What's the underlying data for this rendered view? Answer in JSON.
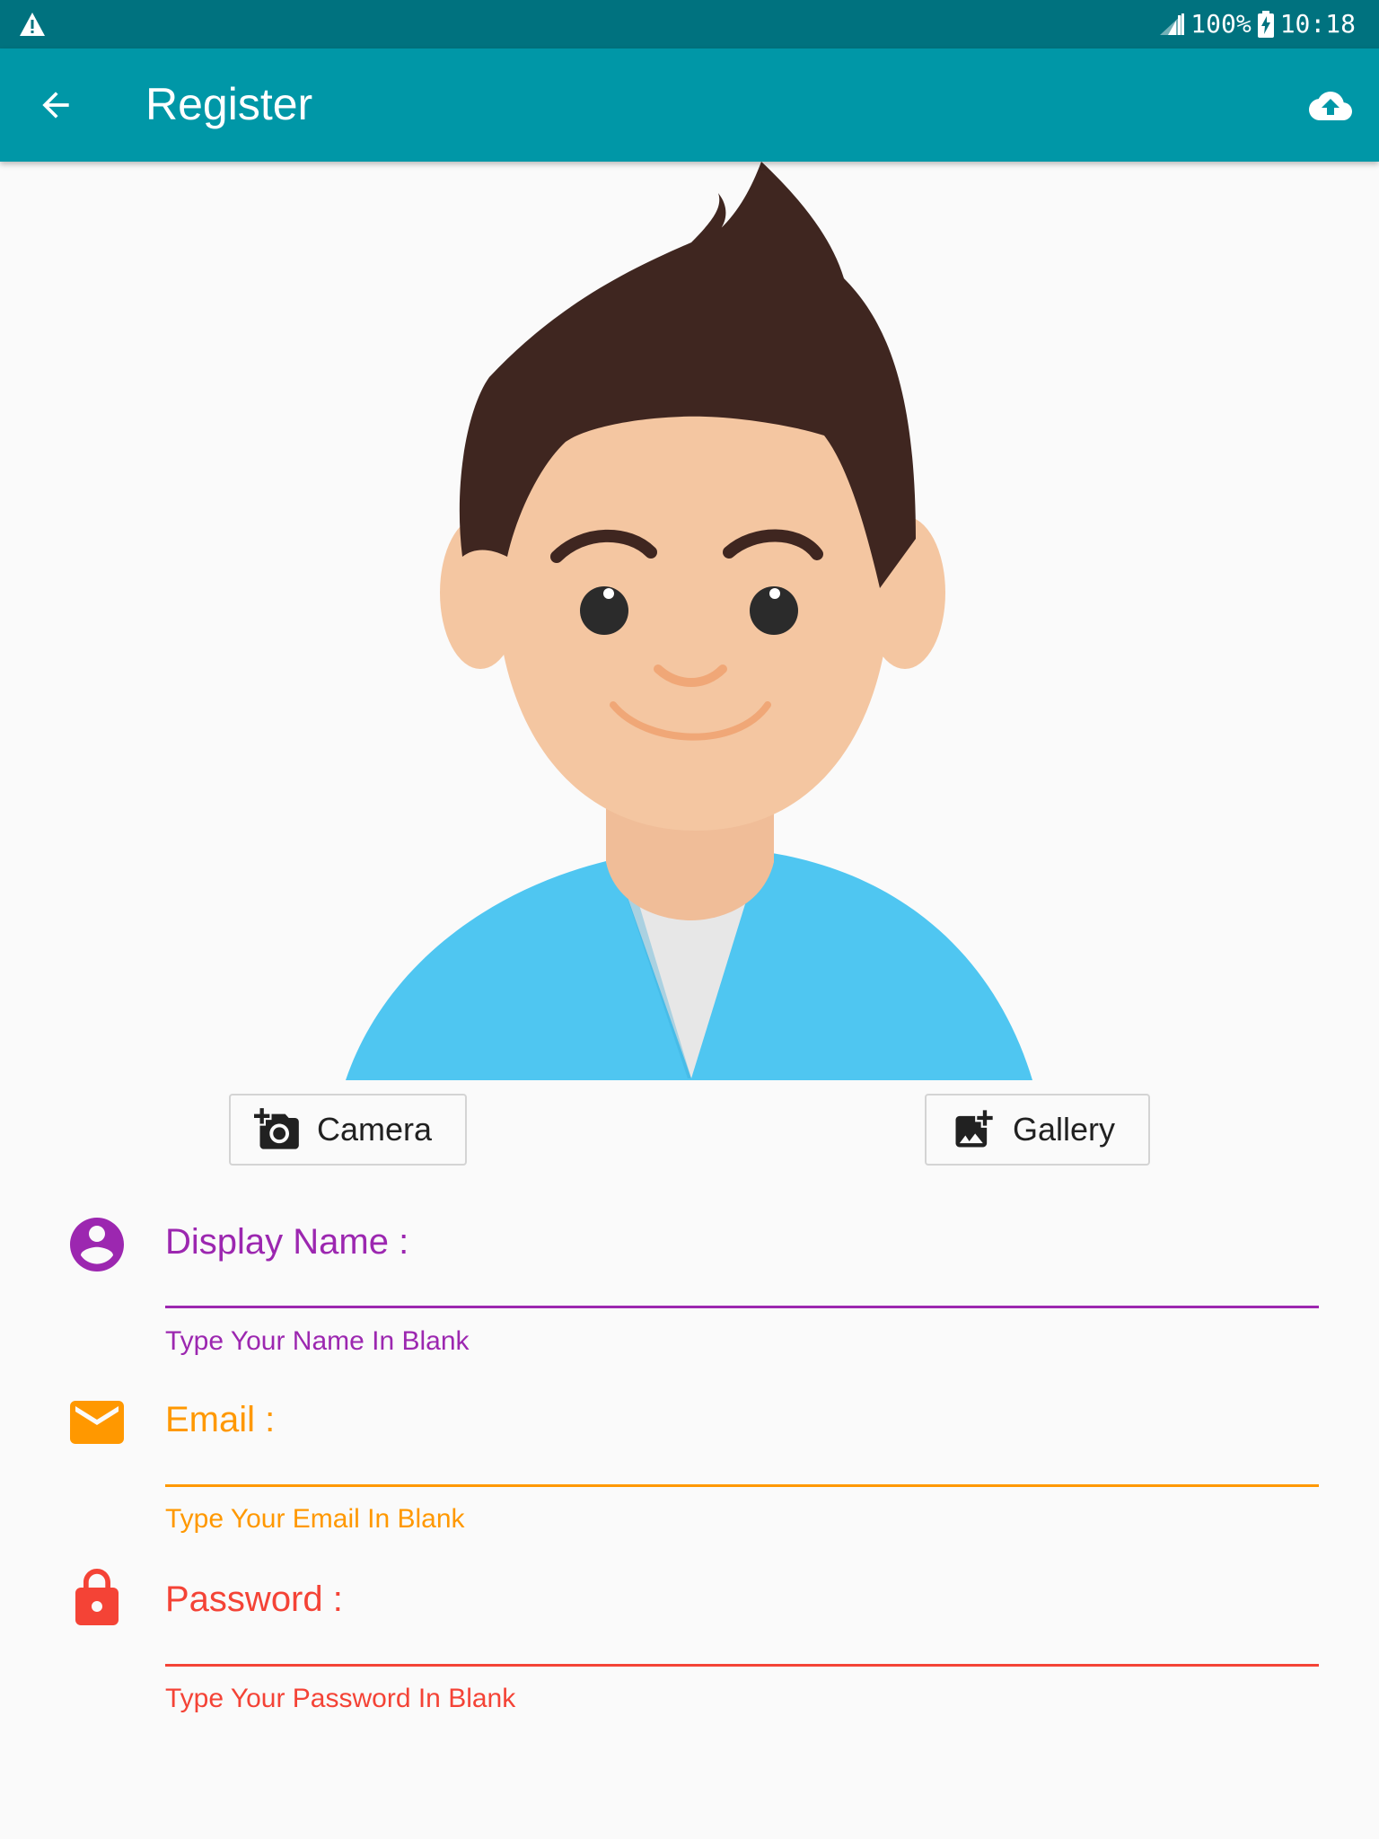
{
  "status_bar": {
    "battery": "100%",
    "time": "10:18",
    "icons": [
      "warning-icon",
      "signal-icon",
      "battery-charging-icon"
    ]
  },
  "app_bar": {
    "title": "Register",
    "icons": [
      "back-arrow-icon",
      "cloud-upload-icon"
    ]
  },
  "avatar": {
    "icon": "cartoon-boy-avatar"
  },
  "photo_buttons": {
    "camera_label": "Camera",
    "camera_icon": "add-camera-icon",
    "gallery_label": "Gallery",
    "gallery_icon": "add-photo-icon"
  },
  "form": {
    "display_name": {
      "label": "Display Name :",
      "helper": "Type Your Name In Blank",
      "value": "",
      "icon": "account-circle-icon",
      "color": "#9c27b0"
    },
    "email": {
      "label": "Email :",
      "helper": "Type Your Email In Blank",
      "value": "",
      "icon": "email-icon",
      "color": "#ff9800"
    },
    "password": {
      "label": "Password :",
      "helper": "Type Your Password In Blank",
      "value": "",
      "icon": "lock-icon",
      "color": "#f44336"
    }
  },
  "colors": {
    "status_bar": "#00727f",
    "app_bar": "#0097a7",
    "background": "#fafafa"
  }
}
